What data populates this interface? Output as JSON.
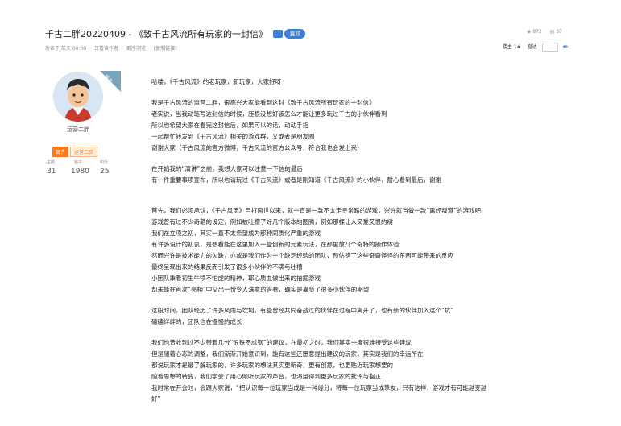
{
  "header": {
    "title": "千古二胖20220409 - 《致千古风流所有玩家的一封信》",
    "tag_label": "置顶",
    "meta": [
      "发表于 前天 00:00",
      "只看该作者",
      "倒序浏览",
      "[复制链接]"
    ],
    "views": "872",
    "replies": "37",
    "floor_label": "楼主 1#",
    "jump_label": "直达"
  },
  "author": {
    "ribbon": "楼主",
    "name": "运营二胖",
    "badge1": "官方",
    "badge2": "运营二胖",
    "stats": [
      {
        "label": "主题",
        "value": "31"
      },
      {
        "label": "帖子",
        "value": "1980"
      },
      {
        "label": "积分",
        "value": "25"
      }
    ]
  },
  "post": {
    "paragraphs": [
      [
        "哈喽，《千古风流》的老玩家，新玩家，大家好呀"
      ],
      [
        "我是千古风流的运营二胖，很高兴大家能看到这封《致千古风流所有玩家的一封信》",
        "老实说，当我动笔写这封信的时候，压根没想好该怎么才能让更多玩过千古的小伙伴看到",
        "所以也希望大家在看完这封信后，如果可以的话，动动手指",
        "一起帮忙转发到《千古风流》相关的游戏群，又或者是朋友圈",
        "谢谢大家（千古风流的官方微博，千古风流的官方公众号，符合我也会发出来）"
      ],
      [
        "在开始我的“演讲”之前，我想大家可以注意一下信的最后",
        "有一件重要事项宣布，所以也请玩过《千古风流》或者是刚知道《千古风流》的小伙伴，耐心看到最后，谢谢"
      ],
      [
        "首先，我们必须承认，《千古风流》自打面世以来，就一直是一款不太走寻常路的游戏，兴许就当做一款“离经叛道”的游戏吧",
        "游戏曾有过不少奇葩的设定，例如被吐槽了好几个版本的图腾，例如那棵让人又爱又恨的树",
        "我们在立项之初，其实一直不太希望成为那种同质化严重的游戏",
        "有许多设计的初衷，是想看能在这里加入一些创新的元素玩法，在那里放几个奇特的操作体验",
        "然而兴许是技术能力的欠缺，亦或是我们作为一个缺乏经验的团队，预估错了这些奇奇怪怪的东西可能带来的反应",
        "最终呈现出来的结果反而引发了很多小伙伴的不满与吐槽",
        "小团队秉着初生牛犊不怕虎的精神，耶心质血做出来的抽掘游戏",
        "却未能在首次“亮相”中交出一份令人满意的答卷，确实是辜负了很多小伙伴的期望"
      ],
      [
        "这段时间，团队经历了许多风雨与坎坷，有些曾经共同奋战过的伙伴在过程中离开了，也有新的伙伴加入这个“坑”",
        "磕磕绊绊的，团队也在慢慢的成长"
      ],
      [
        "我们也曾收到过不少带着几分“恨铁不成钢”的建议，在最初之时，我们其实一度很难接受这些建议",
        "但是随着心态的调整，我们渐渐开始意识到，能有这些还愿意提出建议的玩家，其实是我们的幸运所在",
        "都说玩家才是最了解玩家的，许多玩家的想法其实更新奇，更有创意，也更贴近玩家想要的",
        "随着思想的转变，我们学会了用心倾听玩家的声音，也渴望得到更多玩家的批评与指正",
        "我时常在开会时，会跟大家说，“把认识每一位玩家当成是一种缘分，将每一位玩家当成挚友，只有这样，游戏才有可能越变越",
        "好”"
      ]
    ]
  }
}
